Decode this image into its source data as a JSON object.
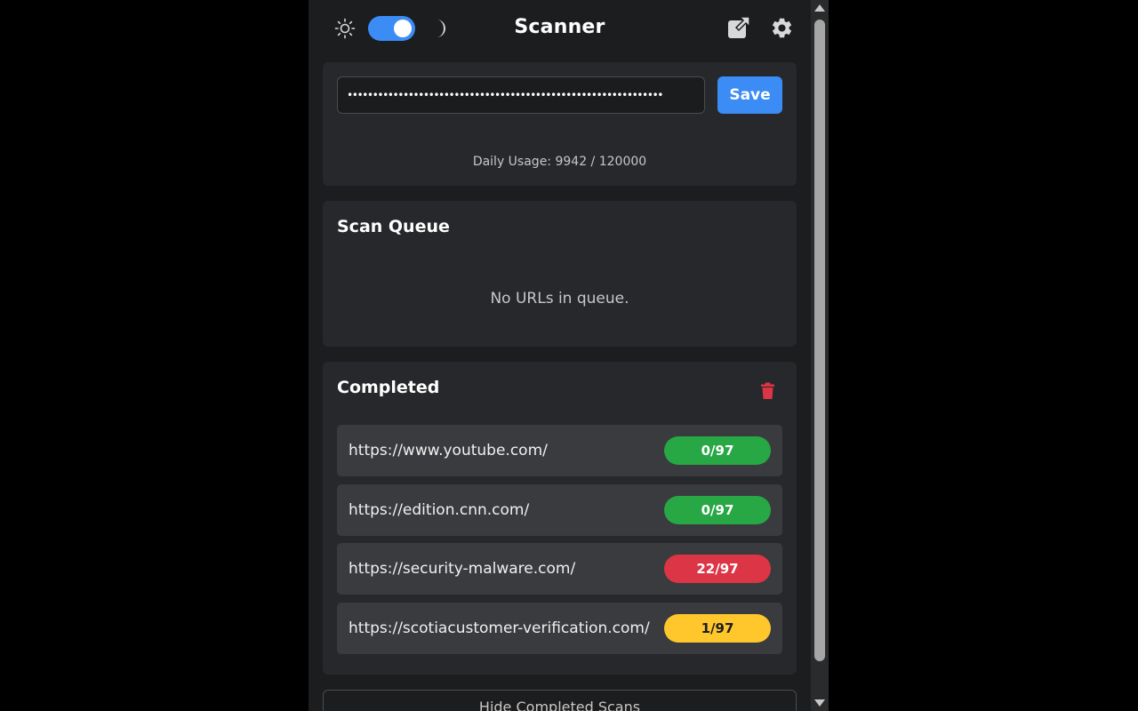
{
  "header": {
    "title": "Scanner",
    "theme_toggle_on": true
  },
  "api": {
    "key_masked": "••••••••••••••••••••••••••••••••••••••••••••••••••••••••••••••",
    "save_label": "Save",
    "usage_text": "Daily Usage: 9942 / 120000"
  },
  "queue": {
    "title": "Scan Queue",
    "empty_text": "No URLs in queue."
  },
  "completed": {
    "title": "Completed",
    "items": [
      {
        "url": "https://www.youtube.com/",
        "result": "0/97",
        "status": "clean"
      },
      {
        "url": "https://edition.cnn.com/",
        "result": "0/97",
        "status": "clean"
      },
      {
        "url": "https://security-malware.com/",
        "result": "22/97",
        "status": "malicious"
      },
      {
        "url": "https://scotiacustomer-verification.com/",
        "result": "1/97",
        "status": "suspicious"
      }
    ]
  },
  "footer": {
    "hide_label": "Hide Completed Scans"
  },
  "colors": {
    "accent": "#3b8cf5",
    "clean": "#28a745",
    "malicious": "#dc3545",
    "suspicious": "#ffc72c",
    "trash": "#dc3545"
  },
  "icons": {
    "sun": "sun-icon",
    "moon": "moon-icon",
    "external": "external-link-icon",
    "settings": "gear-icon",
    "trash": "trash-icon"
  }
}
